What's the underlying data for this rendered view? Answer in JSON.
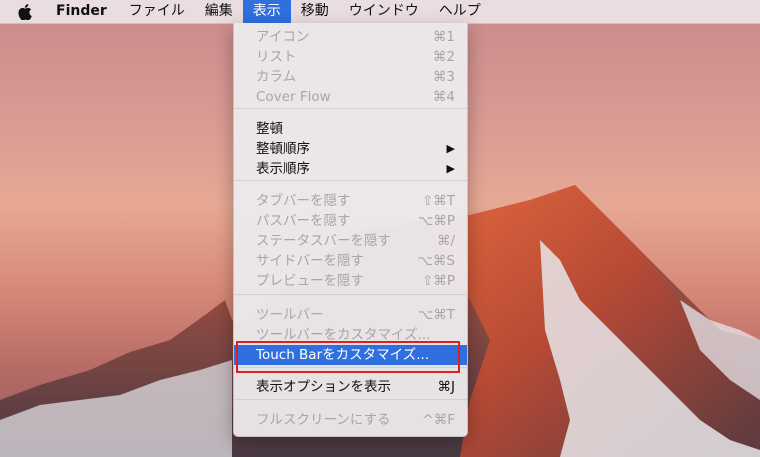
{
  "menubar": {
    "app_name": "Finder",
    "items": [
      "ファイル",
      "編集",
      "表示",
      "移動",
      "ウインドウ",
      "ヘルプ"
    ],
    "active_index": 2
  },
  "dropdown": {
    "groups": [
      [
        {
          "label": "アイコン",
          "shortcut": "⌘1",
          "enabled": false
        },
        {
          "label": "リスト",
          "shortcut": "⌘2",
          "enabled": false
        },
        {
          "label": "カラム",
          "shortcut": "⌘3",
          "enabled": false
        },
        {
          "label": "Cover Flow",
          "shortcut": "⌘4",
          "enabled": false
        }
      ],
      [
        {
          "label": "整頓",
          "shortcut": "",
          "enabled": true
        },
        {
          "label": "整頓順序",
          "shortcut": "▶",
          "enabled": true
        },
        {
          "label": "表示順序",
          "shortcut": "▶",
          "enabled": true
        }
      ],
      [
        {
          "label": "タブバーを隠す",
          "shortcut": "⇧⌘T",
          "enabled": false
        },
        {
          "label": "パスバーを隠す",
          "shortcut": "⌥⌘P",
          "enabled": false
        },
        {
          "label": "ステータスバーを隠す",
          "shortcut": "⌘/",
          "enabled": false
        },
        {
          "label": "サイドバーを隠す",
          "shortcut": "⌥⌘S",
          "enabled": false
        },
        {
          "label": "プレビューを隠す",
          "shortcut": "⇧⌘P",
          "enabled": false
        }
      ],
      [
        {
          "label": "ツールバー",
          "shortcut": "⌥⌘T",
          "enabled": false
        },
        {
          "label": "ツールバーをカスタマイズ...",
          "shortcut": "",
          "enabled": false
        },
        {
          "label": "Touch Barをカスタマイズ...",
          "shortcut": "",
          "enabled": true,
          "selected": true
        }
      ],
      [
        {
          "label": "表示オプションを表示",
          "shortcut": "⌘J",
          "enabled": true
        }
      ],
      [
        {
          "label": "フルスクリーンにする",
          "shortcut": "^⌘F",
          "enabled": false
        }
      ]
    ]
  },
  "colors": {
    "selection": "#2f6fe0",
    "highlight_box": "#e02020",
    "disabled_text": "#a8a5a7"
  }
}
